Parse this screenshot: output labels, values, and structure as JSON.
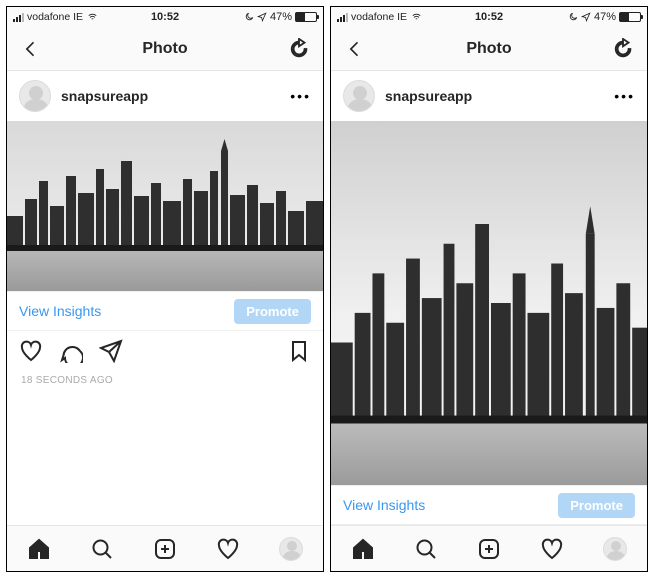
{
  "status": {
    "carrier": "vodafone IE",
    "time": "10:52",
    "battery_pct": "47%"
  },
  "nav": {
    "title": "Photo"
  },
  "post": {
    "username": "snapsureapp",
    "view_insights": "View Insights",
    "promote_label": "Promote",
    "timestamp": "18 SECONDS AGO"
  },
  "colors": {
    "accent": "#3897f0",
    "promote_bg": "#b2d6f5"
  }
}
